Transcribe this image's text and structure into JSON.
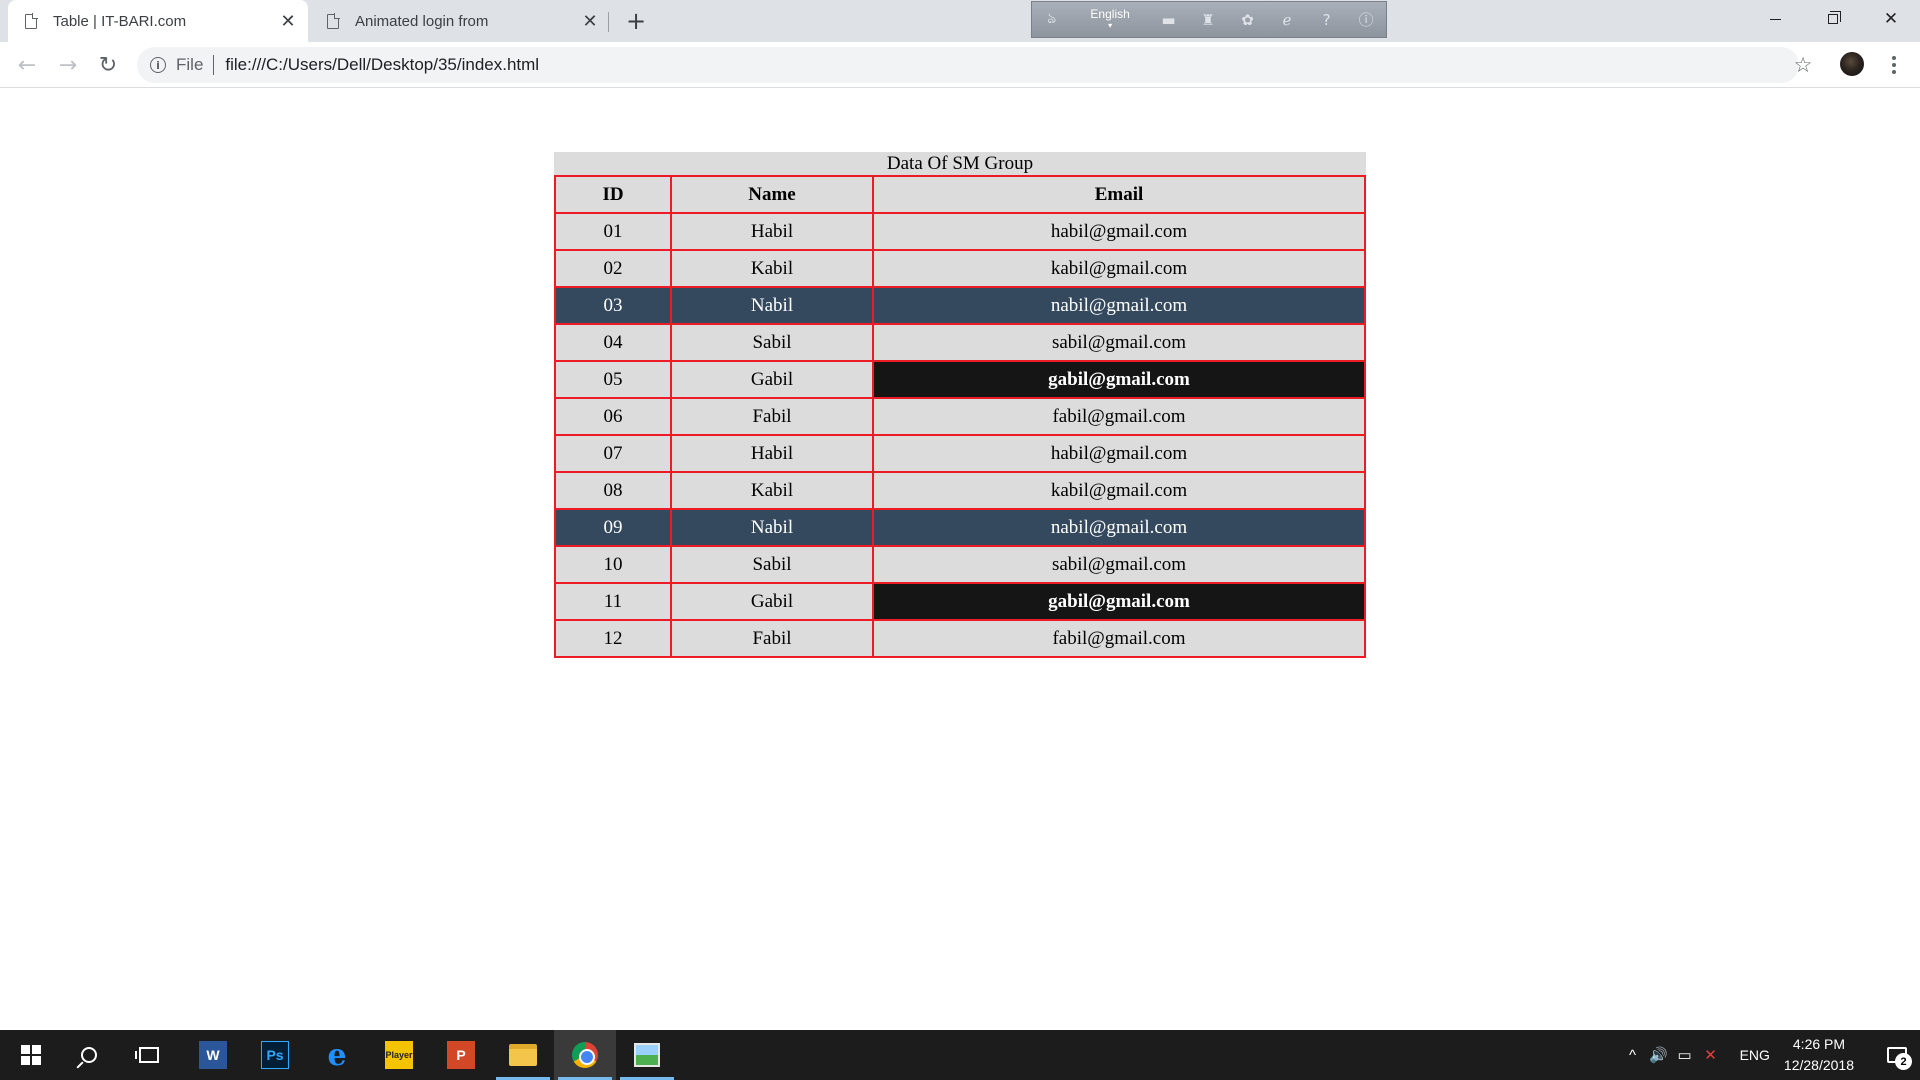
{
  "browser": {
    "tabs": [
      {
        "title": "Table | IT-BARI.com",
        "close": "✕",
        "active": true
      },
      {
        "title": "Animated login from",
        "close": "✕",
        "active": false
      }
    ],
    "new_tab": "+",
    "language_bar": {
      "language": "English",
      "caret": "▾"
    },
    "window_controls": {
      "close": "✕"
    },
    "address": {
      "scheme": "File",
      "url": "file:///C:/Users/Dell/Desktop/35/index.html"
    },
    "nav": {
      "back": "←",
      "forward": "→",
      "reload": "↻"
    },
    "star": "☆"
  },
  "table": {
    "caption": "Data Of SM Group",
    "headers": [
      "ID",
      "Name",
      "Email"
    ],
    "rows": [
      {
        "id": "01",
        "name": "Habil",
        "email": "habil@gmail.com"
      },
      {
        "id": "02",
        "name": "Kabil",
        "email": "kabil@gmail.com"
      },
      {
        "id": "03",
        "name": "Nabil",
        "email": "nabil@gmail.com"
      },
      {
        "id": "04",
        "name": "Sabil",
        "email": "sabil@gmail.com"
      },
      {
        "id": "05",
        "name": "Gabil",
        "email": "gabil@gmail.com"
      },
      {
        "id": "06",
        "name": "Fabil",
        "email": "fabil@gmail.com"
      },
      {
        "id": "07",
        "name": "Habil",
        "email": "habil@gmail.com"
      },
      {
        "id": "08",
        "name": "Kabil",
        "email": "kabil@gmail.com"
      },
      {
        "id": "09",
        "name": "Nabil",
        "email": "nabil@gmail.com"
      },
      {
        "id": "10",
        "name": "Sabil",
        "email": "sabil@gmail.com"
      },
      {
        "id": "11",
        "name": "Gabil",
        "email": "gabil@gmail.com"
      },
      {
        "id": "12",
        "name": "Fabil",
        "email": "fabil@gmail.com"
      }
    ],
    "colors": {
      "border": "#ed1c24",
      "cell_bg": "#dcdcdc",
      "highlight_row": "#34495e",
      "dark_cell": "#151515"
    }
  },
  "taskbar": {
    "apps": [
      {
        "name": "word-icon",
        "label": "W"
      },
      {
        "name": "photoshop-icon",
        "label": "Ps"
      },
      {
        "name": "edge-icon",
        "label": "e"
      },
      {
        "name": "player-icon",
        "label": "Player"
      },
      {
        "name": "powerpoint-icon",
        "label": "P"
      },
      {
        "name": "file-explorer-icon",
        "label": ""
      },
      {
        "name": "chrome-icon",
        "label": ""
      },
      {
        "name": "image-viewer-icon",
        "label": ""
      }
    ],
    "tray": {
      "language": "ENG",
      "time": "4:26 PM",
      "date": "12/28/2018",
      "notification_count": "2",
      "chevron": "^",
      "volume": "🔊"
    }
  }
}
